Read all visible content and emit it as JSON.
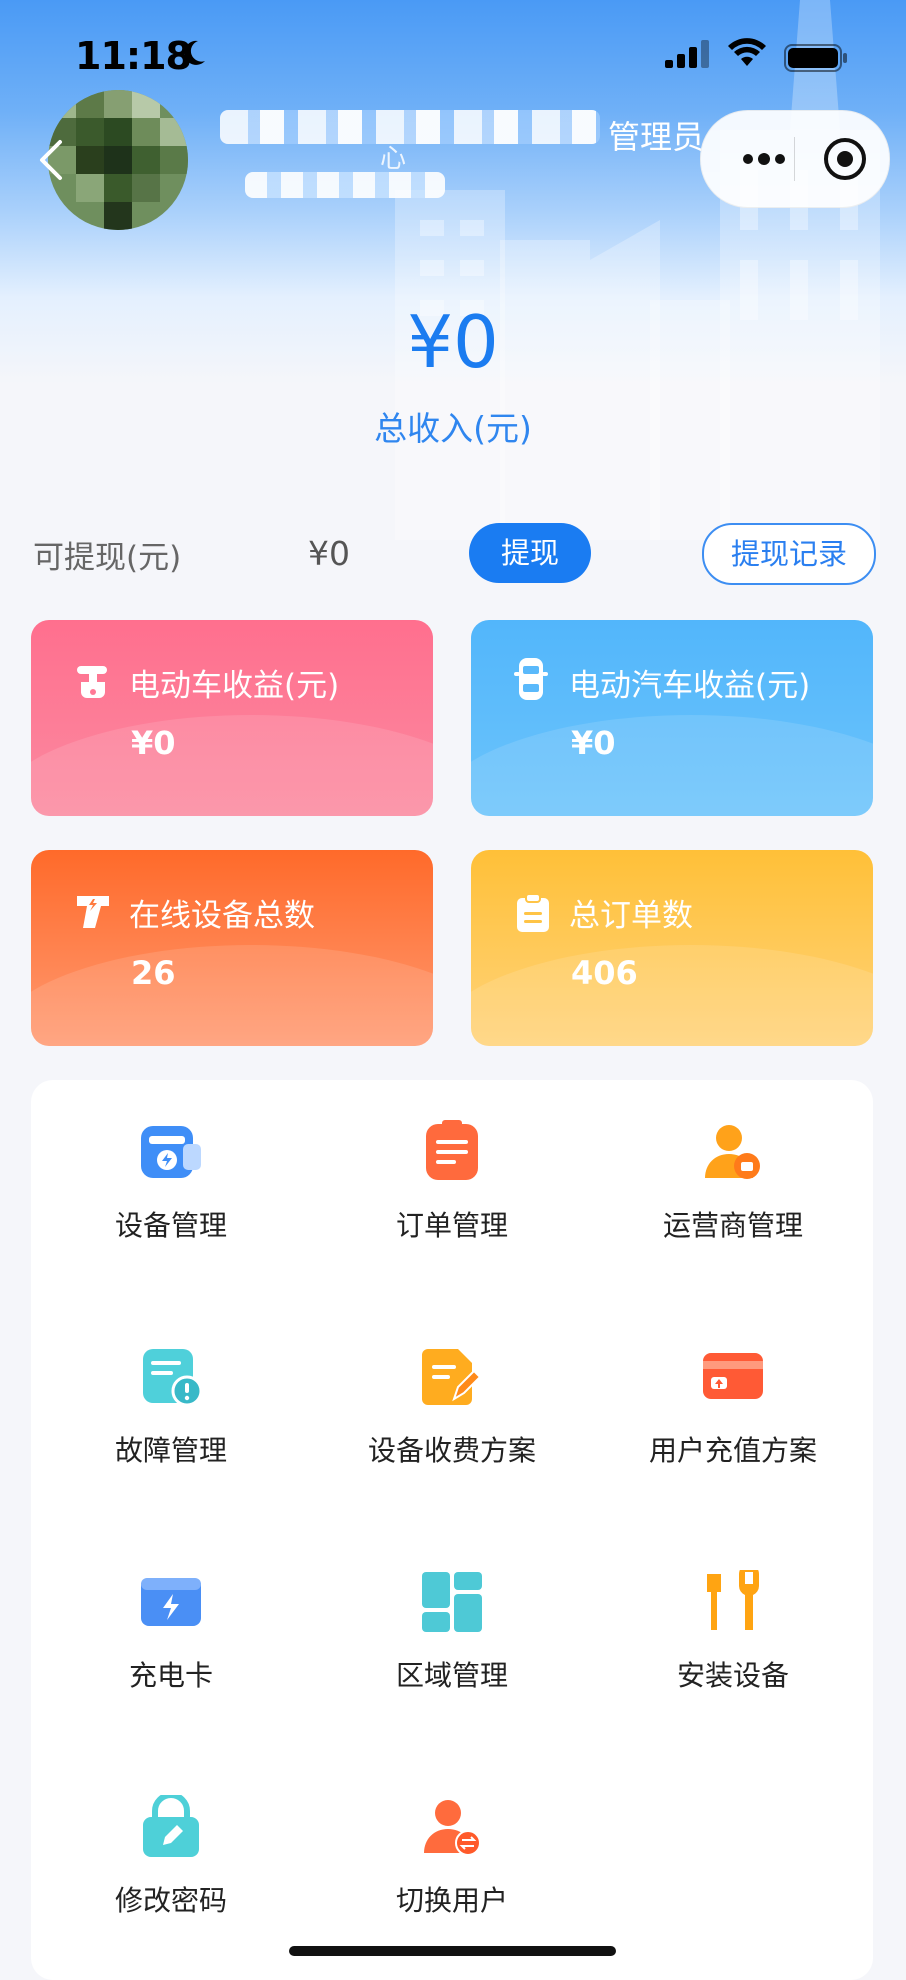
{
  "status_bar": {
    "time": "11:18"
  },
  "header": {
    "role": "管理员",
    "subtitle_fragment": "心"
  },
  "summary": {
    "total_amount": "¥0",
    "total_label": "总收入(元)",
    "withdrawable_label": "可提现(元)",
    "withdrawable_value": "¥0",
    "withdraw_button": "提现",
    "withdraw_record_button": "提现记录"
  },
  "cards": [
    {
      "title": "电动车收益(元)",
      "value": "¥0",
      "icon": "scooter-icon",
      "color": "#ff6f8e"
    },
    {
      "title": "电动汽车收益(元)",
      "value": "¥0",
      "icon": "car-icon",
      "color": "#52b6fb"
    },
    {
      "title": "在线设备总数",
      "value": "26",
      "icon": "charger-icon",
      "color": "#ff6a2a"
    },
    {
      "title": "总订单数",
      "value": "406",
      "icon": "clipboard-icon",
      "color": "#ffc038"
    }
  ],
  "menu": [
    {
      "label": "设备管理",
      "icon": "device-icon"
    },
    {
      "label": "订单管理",
      "icon": "order-icon"
    },
    {
      "label": "运营商管理",
      "icon": "operator-icon"
    },
    {
      "label": "故障管理",
      "icon": "fault-icon"
    },
    {
      "label": "设备收费方案",
      "icon": "fee-plan-icon"
    },
    {
      "label": "用户充值方案",
      "icon": "recharge-plan-icon"
    },
    {
      "label": "充电卡",
      "icon": "charge-card-icon"
    },
    {
      "label": "区域管理",
      "icon": "region-icon"
    },
    {
      "label": "安装设备",
      "icon": "install-icon"
    },
    {
      "label": "修改密码",
      "icon": "password-icon"
    },
    {
      "label": "切换用户",
      "icon": "switch-user-icon"
    }
  ]
}
